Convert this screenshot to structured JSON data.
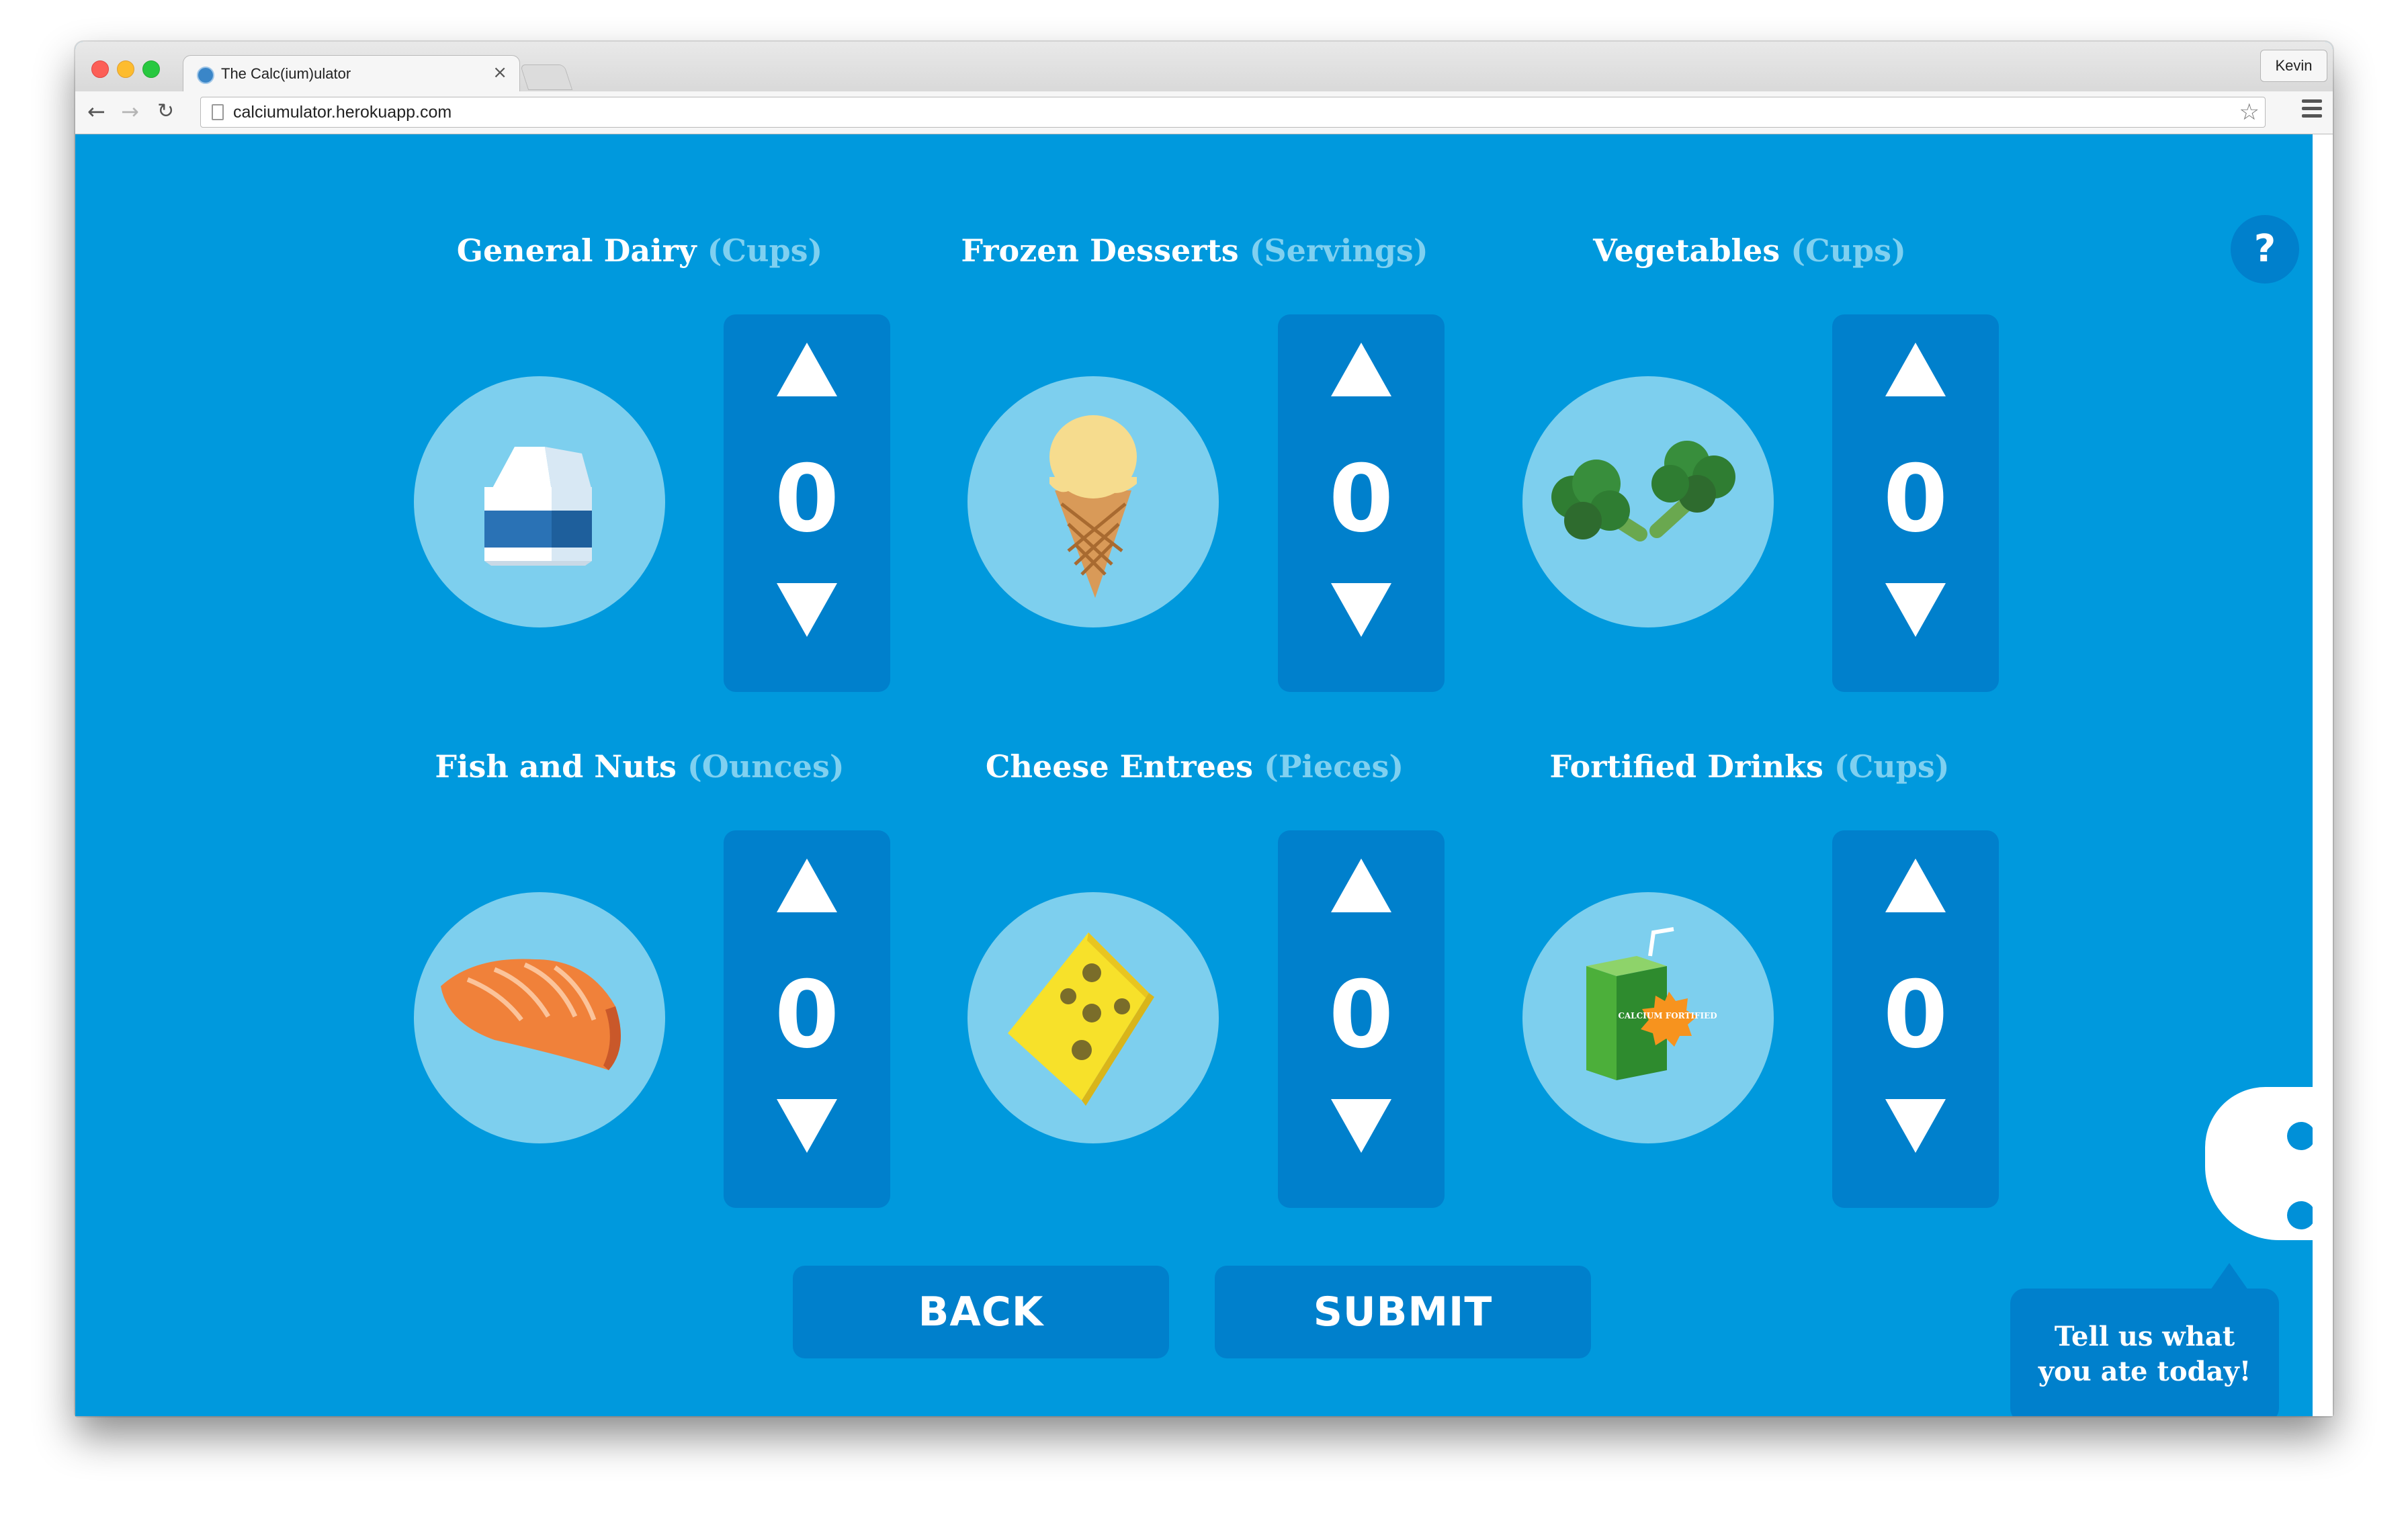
{
  "browser": {
    "tab_title": "The Calc(ium)ulator",
    "url": "calciumulator.herokuapp.com",
    "profile_name": "Kevin"
  },
  "categories": [
    {
      "name": "General Dairy",
      "unit": "(Cups)",
      "icon": "milk-carton-icon",
      "count": "0"
    },
    {
      "name": "Frozen Desserts",
      "unit": "(Servings)",
      "icon": "ice-cream-cone-icon",
      "count": "0"
    },
    {
      "name": "Vegetables",
      "unit": "(Cups)",
      "icon": "broccoli-icon",
      "count": "0"
    },
    {
      "name": "Fish and Nuts",
      "unit": "(Ounces)",
      "icon": "salmon-fillet-icon",
      "count": "0"
    },
    {
      "name": "Cheese Entrees",
      "unit": "(Pieces)",
      "icon": "cheese-wedge-icon",
      "count": "0"
    },
    {
      "name": "Fortified Drinks",
      "unit": "(Cups)",
      "icon": "juice-box-icon",
      "count": "0"
    }
  ],
  "juice_badge": "CALCIUM FORTIFIED",
  "buttons": {
    "back": "BACK",
    "submit": "SUBMIT"
  },
  "help_label": "?",
  "speech_bubble": {
    "line1": "Tell us what",
    "line2": "you ate today!"
  },
  "colors": {
    "page_bg": "#0099dd",
    "panel": "#0080cc",
    "circle": "#7dcfee",
    "unit_text": "#7fd0f0"
  }
}
